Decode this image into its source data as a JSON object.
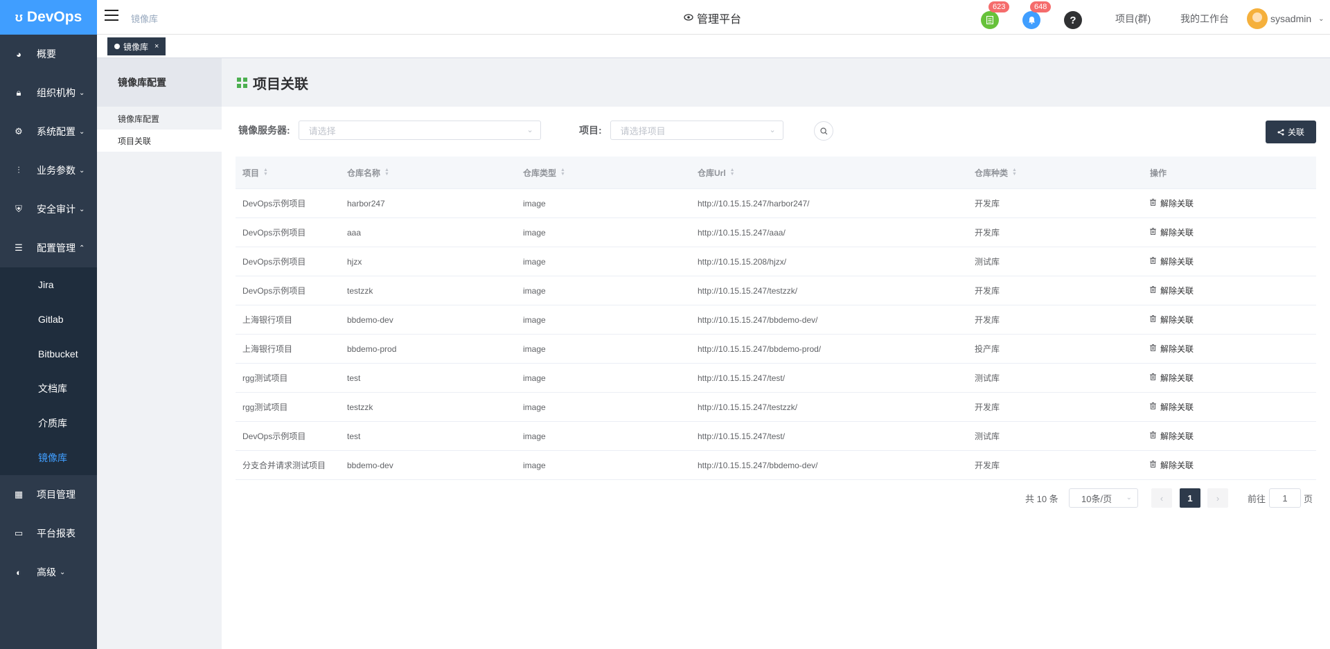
{
  "app": {
    "logo": "DevOps"
  },
  "sidebar": {
    "items": [
      {
        "label": "概要",
        "icon": "dashboard-icon",
        "arrow": ""
      },
      {
        "label": "组织机构",
        "icon": "lock-icon",
        "arrow": "⌄"
      },
      {
        "label": "系统配置",
        "icon": "gear-icon",
        "arrow": "⌄"
      },
      {
        "label": "业务参数",
        "icon": "sliders-icon",
        "arrow": "⌄"
      },
      {
        "label": "安全审计",
        "icon": "shield-icon",
        "arrow": "⌄"
      },
      {
        "label": "配置管理",
        "icon": "database-icon",
        "arrow": "⌃"
      }
    ],
    "submenu": [
      "Jira",
      "Gitlab",
      "Bitbucket",
      "文档库",
      "介质库",
      "镜像库"
    ],
    "items_after": [
      {
        "label": "项目管理",
        "icon": "grid-icon",
        "arrow": ""
      },
      {
        "label": "平台报表",
        "icon": "monitor-icon",
        "arrow": ""
      },
      {
        "label": "高级",
        "icon": "palette-icon",
        "arrow": "⌄"
      }
    ]
  },
  "header": {
    "breadcrumb": "镜像库",
    "platform": "管理平台",
    "badge_tasks": "623",
    "badge_notifications": "648",
    "link_projects": "项目(群)",
    "link_workbench": "我的工作台",
    "username": "sysadmin"
  },
  "tags": {
    "active": "镜像库"
  },
  "subpanel": {
    "title": "镜像库配置",
    "items": [
      "镜像库配置",
      "项目关联"
    ]
  },
  "main": {
    "title": "项目关联",
    "filter_server_label": "镜像服务器:",
    "filter_server_placeholder": "请选择",
    "filter_project_label": "项目:",
    "filter_project_placeholder": "请选择项目",
    "associate_button": "关联"
  },
  "table": {
    "headers": [
      "项目",
      "仓库名称",
      "仓库类型",
      "仓库Url",
      "仓库种类",
      "操作"
    ],
    "action_label": "解除关联",
    "rows": [
      [
        "DevOps示例项目",
        "harbor247",
        "image",
        "http://10.15.15.247/harbor247/",
        "开发库"
      ],
      [
        "DevOps示例项目",
        "aaa",
        "image",
        "http://10.15.15.247/aaa/",
        "开发库"
      ],
      [
        "DevOps示例项目",
        "hjzx",
        "image",
        "http://10.15.15.208/hjzx/",
        "测试库"
      ],
      [
        "DevOps示例项目",
        "testzzk",
        "image",
        "http://10.15.15.247/testzzk/",
        "开发库"
      ],
      [
        "上海银行项目",
        "bbdemo-dev",
        "image",
        "http://10.15.15.247/bbdemo-dev/",
        "开发库"
      ],
      [
        "上海银行项目",
        "bbdemo-prod",
        "image",
        "http://10.15.15.247/bbdemo-prod/",
        "投产库"
      ],
      [
        "rgg测试项目",
        "test",
        "image",
        "http://10.15.15.247/test/",
        "测试库"
      ],
      [
        "rgg测试项目",
        "testzzk",
        "image",
        "http://10.15.15.247/testzzk/",
        "开发库"
      ],
      [
        "DevOps示例项目",
        "test",
        "image",
        "http://10.15.15.247/test/",
        "测试库"
      ],
      [
        "分支合并请求测试项目",
        "bbdemo-dev",
        "image",
        "http://10.15.15.247/bbdemo-dev/",
        "开发库"
      ]
    ]
  },
  "pagination": {
    "total": "共 10 条",
    "page_size": "10条/页",
    "current_page": "1",
    "goto_label": "前往",
    "goto_value": "1",
    "page_unit": "页"
  },
  "colors": {
    "accent": "#409eff",
    "sidebar": "#2d3a4b",
    "submenu": "#1f2d3d",
    "danger": "#f56c6c"
  }
}
